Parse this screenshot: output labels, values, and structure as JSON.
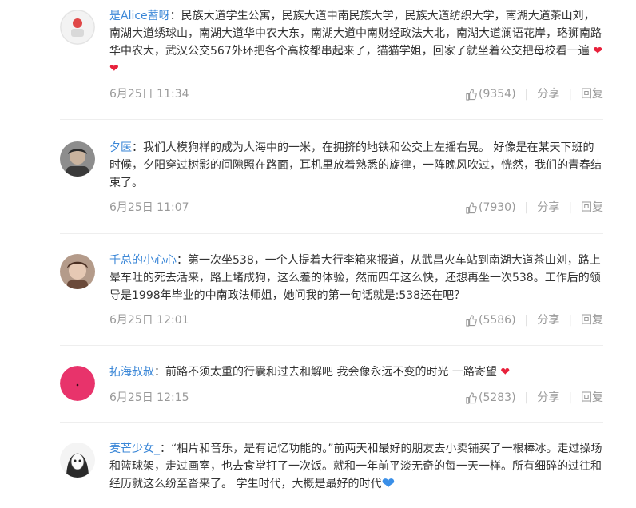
{
  "comments": [
    {
      "username": "是Alice蓄呀",
      "text": "民族大道学生公寓，民族大道中南民族大学，民族大道纺织大学，南湖大道茶山刘，南湖大道绣球山，南湖大道华中农大东，南湖大道中南财经政法大北，南湖大道澜语花岸，珞狮南路华中农大，武汉公交567外环把各个高校都串起来了，猫猫学姐，回家了就坐着公交把母校看一遍",
      "time": "6月25日 11:34",
      "likes": "(9354)",
      "share": "分享",
      "reply": "回复"
    },
    {
      "username": "夕医",
      "text": "我们人模狗样的成为人海中的一米，在拥挤的地铁和公交上左摇右晃。 好像是在某天下班的时候，夕阳穿过树影的间隙照在路面，耳机里放着熟悉的旋律，一阵晚风吹过，恍然，我们的青春结束了。",
      "time": "6月25日 11:07",
      "likes": "(7930)",
      "share": "分享",
      "reply": "回复"
    },
    {
      "username": "千总的小心心",
      "text": "第一次坐538，一个人提着大行李箱来报道，从武昌火车站到南湖大道茶山刘，路上晕车吐的死去活来，路上堵成狗，这么差的体验，然而四年这么快，还想再坐一次538。工作后的领导是1998年毕业的中南政法师姐，她问我的第一句话就是:538还在吧？",
      "time": "6月25日 12:01",
      "likes": "(5586)",
      "share": "分享",
      "reply": "回复"
    },
    {
      "username": "拓海叔叔",
      "text": "前路不须太重的行囊和过去和解吧 我会像永远不变的时光 一路寄望",
      "time": "6月25日 12:15",
      "likes": "(5283)",
      "share": "分享",
      "reply": "回复"
    },
    {
      "username": "麦芒少女_",
      "text": "“相片和音乐，是有记忆功能的。”前两天和最好的朋友去小卖铺买了一根棒冰。走过操场和篮球架，走过画室，也去食堂打了一次饭。就和一年前平淡无奇的每一天一样。所有细碎的过往和经历就这么纷至沓来了。 学生时代，大概是最好的时代"
    }
  ],
  "colors": {
    "username": "#3b87d7",
    "text": "#333333",
    "meta": "#999999",
    "heart_red": "#e8213b",
    "heart_blue": "#3a8fe8"
  }
}
